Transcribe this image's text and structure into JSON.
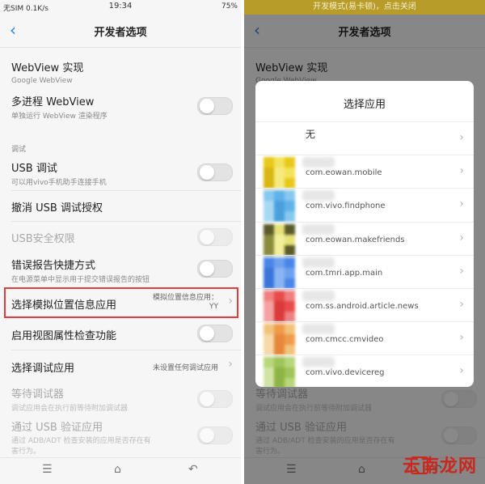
{
  "left_screen": {
    "status": {
      "carrier": "无SIM 0.1K/s",
      "time": "19:34",
      "battery": "75%"
    },
    "title": "开发者选项",
    "rows": [
      {
        "title": "WebView 实现",
        "subtitle": "Google WebView"
      },
      {
        "title": "多进程 WebView",
        "subtitle": "单独运行 WebView 渲染程序"
      },
      {
        "section": "调试"
      },
      {
        "title": "USB 调试",
        "subtitle": "可以用vivo手机助手连接手机"
      },
      {
        "title": "撤消 USB 调试授权"
      },
      {
        "title": "USB安全权限"
      },
      {
        "title": "错误报告快捷方式",
        "subtitle": "在电源菜单中显示用于提交错误报告的按钮"
      },
      {
        "title": "选择模拟位置信息应用",
        "value": "模拟位置信息应用：",
        "value2": "YY"
      },
      {
        "title": "启用视图属性检查功能"
      },
      {
        "title": "选择调试应用",
        "value": "未设置任何调试应用"
      },
      {
        "title": "等待调试器",
        "subtitle": "调试应用会在执行前等待附加调试器"
      },
      {
        "title": "通过 USB 验证应用",
        "subtitle": "通过 ADB/ADT 检查安装的应用是否存在有",
        "subtitle2": "害行为。"
      }
    ]
  },
  "right_screen": {
    "banner": "开发模式(易卡顿)，点击关闭",
    "title": "开发者选项",
    "bg_rows": [
      {
        "title": "WebView 实现",
        "subtitle": "Google WebView"
      },
      {
        "title": "等待调试器",
        "subtitle": "调试应用会在执行前等待附加调试器"
      },
      {
        "title": "通过 USB 验证应用",
        "subtitle": "通过 ADB/ADT 检查安装的应用是否存在有",
        "subtitle2": "害行为。"
      }
    ],
    "dialog": {
      "title": "选择应用",
      "items": [
        {
          "name": "无"
        },
        {
          "name": "com.eowan.mobile",
          "colors": [
            "#e8c81a",
            "#f3e35a",
            "#d9b612",
            "#f5ea7e"
          ]
        },
        {
          "name": "com.vivo.findphone",
          "colors": [
            "#86c8ef",
            "#5fb3e8",
            "#a8d8f4",
            "#4aa0dd"
          ]
        },
        {
          "name": "com.eowan.makefriends",
          "colors": [
            "#5a5a2a",
            "#e6e27a",
            "#8b8b3c",
            "#f2ee9a"
          ]
        },
        {
          "name": "com.tmri.app.main",
          "colors": [
            "#4a86e8",
            "#6ea0ee",
            "#3a75d8",
            "#8ab4f2"
          ]
        },
        {
          "name": "com.ss.android.article.news",
          "colors": [
            "#f08080",
            "#e84b4b",
            "#f4a2a2",
            "#d93a3a"
          ]
        },
        {
          "name": "com.cmcc.cmvideo",
          "colors": [
            "#f3c27a",
            "#ef9b4a",
            "#f7d8a8",
            "#e6883a"
          ]
        },
        {
          "name": "com.vivo.devicereg",
          "colors": [
            "#b8d67a",
            "#9ec45a",
            "#d0e4a6",
            "#8db444"
          ]
        }
      ]
    }
  },
  "watermark": "云南龙网"
}
